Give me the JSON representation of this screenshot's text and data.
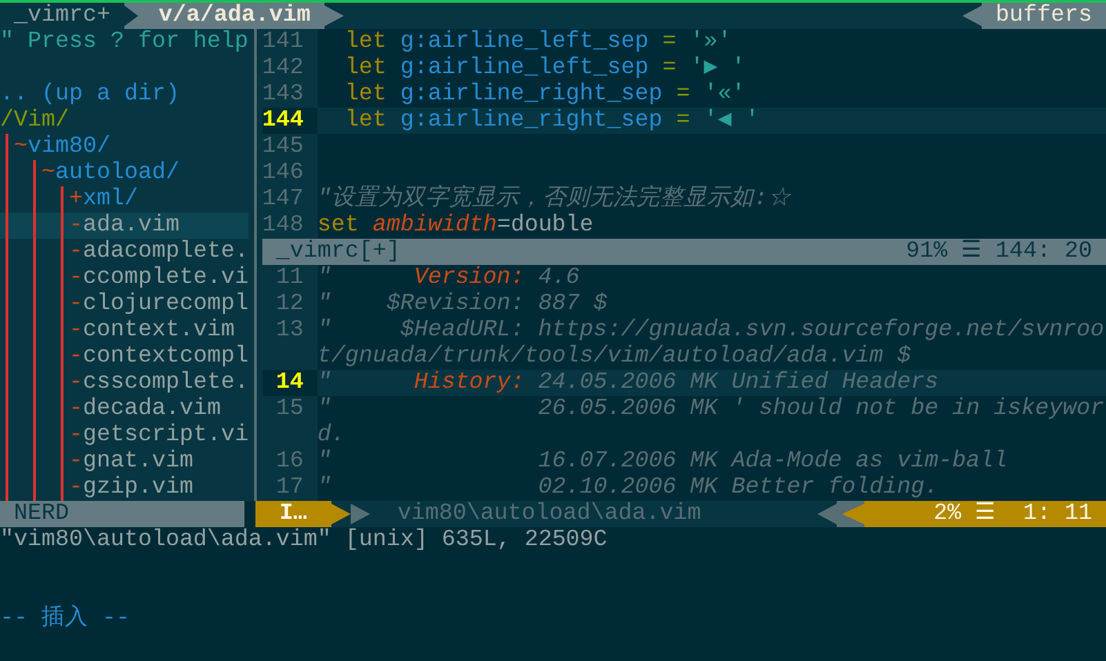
{
  "tabline": {
    "tabs": [
      {
        "label": "_vimrc+",
        "selected": false
      },
      {
        "label": "v/a/ada.vim",
        "selected": true
      }
    ],
    "right_label": "buffers"
  },
  "nerd_tree": {
    "help": "\" Press ? for help",
    "up_dir": ".. (up a dir)",
    "root": {
      "name": "/Vim/",
      "kind": "root",
      "selected": false,
      "children": [
        {
          "marker": "~",
          "name": "vim80/",
          "kind": "dir",
          "selected": false,
          "children": [
            {
              "marker": "~",
              "name": "autoload/",
              "kind": "dir",
              "selected": false,
              "children": [
                {
                  "marker": "+",
                  "name": "xml/",
                  "kind": "dir",
                  "selected": false
                },
                {
                  "marker": "-",
                  "name": "ada.vim",
                  "kind": "file",
                  "selected": true
                },
                {
                  "marker": "-",
                  "name": "adacomplete.",
                  "kind": "file",
                  "selected": false
                },
                {
                  "marker": "-",
                  "name": "ccomplete.vi",
                  "kind": "file",
                  "selected": false
                },
                {
                  "marker": "-",
                  "name": "clojurecompl",
                  "kind": "file",
                  "selected": false
                },
                {
                  "marker": "-",
                  "name": "context.vim",
                  "kind": "file",
                  "selected": false
                },
                {
                  "marker": "-",
                  "name": "contextcompl",
                  "kind": "file",
                  "selected": false
                },
                {
                  "marker": "-",
                  "name": "csscomplete.",
                  "kind": "file",
                  "selected": false
                },
                {
                  "marker": "-",
                  "name": "decada.vim",
                  "kind": "file",
                  "selected": false
                },
                {
                  "marker": "-",
                  "name": "getscript.vi",
                  "kind": "file",
                  "selected": false
                },
                {
                  "marker": "-",
                  "name": "gnat.vim",
                  "kind": "file",
                  "selected": false
                },
                {
                  "marker": "-",
                  "name": "gzip.vim",
                  "kind": "file",
                  "selected": false
                }
              ]
            }
          ]
        }
      ]
    },
    "status": "NERD"
  },
  "top_window": {
    "lines": [
      {
        "number": "141",
        "current": false,
        "segments": [
          {
            "text": "  let",
            "kind": "keyword"
          },
          {
            "text": " g:airline_left_sep",
            "kind": "ident"
          },
          {
            "text": " = ",
            "kind": "op"
          },
          {
            "text": "'»'",
            "kind": "string"
          }
        ]
      },
      {
        "number": "142",
        "current": false,
        "segments": [
          {
            "text": "  let",
            "kind": "keyword"
          },
          {
            "text": " g:airline_left_sep",
            "kind": "ident"
          },
          {
            "text": " = ",
            "kind": "op"
          },
          {
            "text": "'▶ '",
            "kind": "string"
          }
        ]
      },
      {
        "number": "143",
        "current": false,
        "segments": [
          {
            "text": "  let",
            "kind": "keyword"
          },
          {
            "text": " g:airline_right_sep",
            "kind": "ident"
          },
          {
            "text": " = ",
            "kind": "op"
          },
          {
            "text": "'«'",
            "kind": "string"
          }
        ]
      },
      {
        "number": "144",
        "current": true,
        "segments": [
          {
            "text": "  let",
            "kind": "keyword"
          },
          {
            "text": " g:airline_right_sep",
            "kind": "ident"
          },
          {
            "text": " = ",
            "kind": "op"
          },
          {
            "text": "'◀ '",
            "kind": "string"
          }
        ]
      },
      {
        "number": "145",
        "current": false
      },
      {
        "number": "146",
        "current": false
      },
      {
        "number": "147",
        "current": false,
        "segments": [
          {
            "text": "\"设置为双字宽显示，否则无法完整显示如:☆",
            "kind": "comment"
          }
        ]
      },
      {
        "number": "148",
        "current": false,
        "segments": [
          {
            "text": "set",
            "kind": "keyword"
          },
          {
            "text": " ambiwidth",
            "kind": "special"
          },
          {
            "text": "=double",
            "kind": "plain"
          }
        ]
      }
    ],
    "status": {
      "file": "_vimrc[+]",
      "percent": "91%",
      "lines_icon": "☰",
      "position": "144: 20"
    }
  },
  "bottom_window": {
    "lines": [
      {
        "number": "11",
        "current": false,
        "segments": [
          {
            "text": "\"      ",
            "kind": "comment"
          },
          {
            "text": "Version:",
            "kind": "special"
          },
          {
            "text": " 4.6",
            "kind": "comment"
          }
        ]
      },
      {
        "number": "12",
        "current": false,
        "segments": [
          {
            "text": "\"    $Revision: 887 $",
            "kind": "comment"
          }
        ]
      },
      {
        "number": "13",
        "current": false,
        "segments": [
          {
            "text": "\"     $HeadURL: https://gnuada.svn.sourceforge.net/svnroo",
            "kind": "comment"
          }
        ]
      },
      {
        "current": false,
        "segments": [
          {
            "text": "t/gnuada/trunk/tools/vim/autoload/ada.vim $",
            "kind": "comment"
          }
        ]
      },
      {
        "number": "14",
        "current": true,
        "segments": [
          {
            "text": "\"      ",
            "kind": "comment"
          },
          {
            "text": "History:",
            "kind": "special"
          },
          {
            "text": " 24.05.2006 MK Unified Headers",
            "kind": "comment"
          }
        ]
      },
      {
        "number": "15",
        "current": false,
        "segments": [
          {
            "text": "\"               26.05.2006 MK ' should not be in iskeywor",
            "kind": "comment"
          }
        ]
      },
      {
        "current": false,
        "segments": [
          {
            "text": "d.",
            "kind": "comment"
          }
        ]
      },
      {
        "number": "16",
        "current": false,
        "segments": [
          {
            "text": "\"               16.07.2006 MK Ada-Mode as vim-ball",
            "kind": "comment"
          }
        ]
      },
      {
        "number": "17",
        "current": false,
        "segments": [
          {
            "text": "\"               02.10.2006 MK Better folding.",
            "kind": "comment"
          }
        ]
      }
    ],
    "status": {
      "mode": "I…",
      "path": "vim80\\autoload\\ada.vim",
      "percent": "2%",
      "lines_icon": "☰",
      "position": "1: 11"
    }
  },
  "command_line": {
    "message": "\"vim80\\autoload\\ada.vim\" [unix] 635L, 22509C",
    "mode": "-- 插入 --"
  }
}
